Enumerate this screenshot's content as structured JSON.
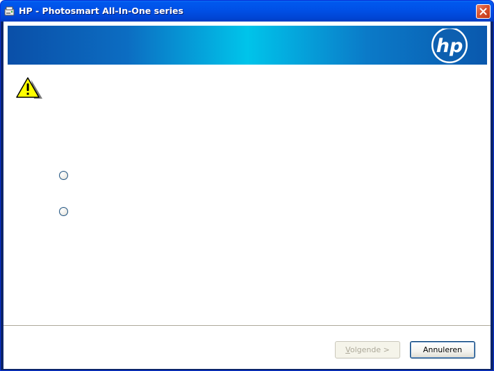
{
  "window": {
    "title": "HP - Photosmart All-In-One series"
  },
  "banner": {
    "logo_text": "hp"
  },
  "icons": {
    "app": "hp-setup-icon",
    "close": "close-icon",
    "warning": "warning-icon"
  },
  "options": [
    {
      "label": "",
      "selected": false
    },
    {
      "label": "",
      "selected": false
    }
  ],
  "buttons": {
    "next_hotkey": "V",
    "next_rest": "olgende >",
    "next_enabled": false,
    "cancel": "Annuleren"
  },
  "colors": {
    "titlebar": "#0054e3",
    "banner_center": "#00c4ea",
    "banner_edge": "#0a4fa8",
    "close_button": "#d7522f",
    "warning_yellow": "#ffff00"
  }
}
